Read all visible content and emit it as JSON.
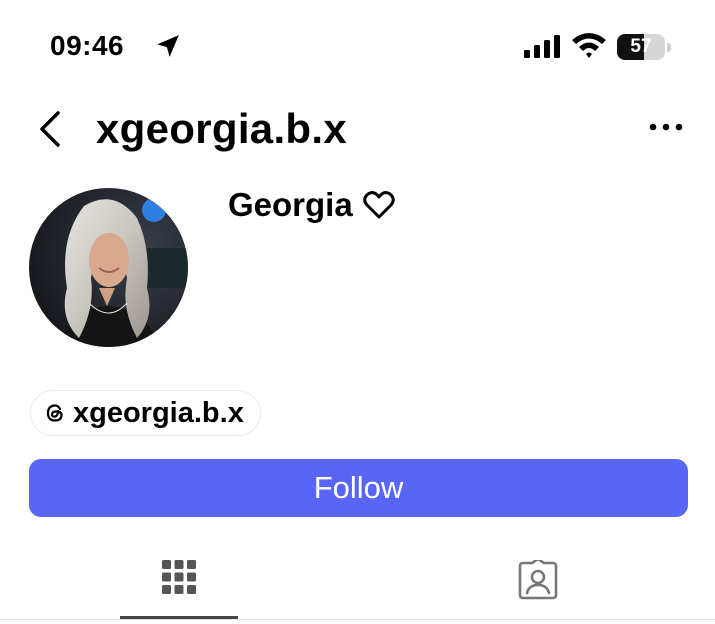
{
  "status_bar": {
    "time": "09:46",
    "battery_level": "57",
    "icons": [
      "location-arrow-icon",
      "cellular-signal-icon",
      "wifi-icon",
      "battery-icon"
    ]
  },
  "header": {
    "title": "xgeorgia.b.x",
    "icons": [
      "back-chevron-icon",
      "more-options-icon"
    ]
  },
  "profile": {
    "display_name": "Georgia",
    "name_suffix_icon": "heart-outline-icon",
    "avatar": "profile-photo"
  },
  "threads_badge": {
    "handle": "xgeorgia.b.x",
    "icon": "threads-icon"
  },
  "follow_button": {
    "label": "Follow",
    "color": "#5865f7"
  },
  "tabs": [
    {
      "icon": "grid-icon",
      "selected": true
    },
    {
      "icon": "tagged-person-icon",
      "selected": false
    }
  ]
}
